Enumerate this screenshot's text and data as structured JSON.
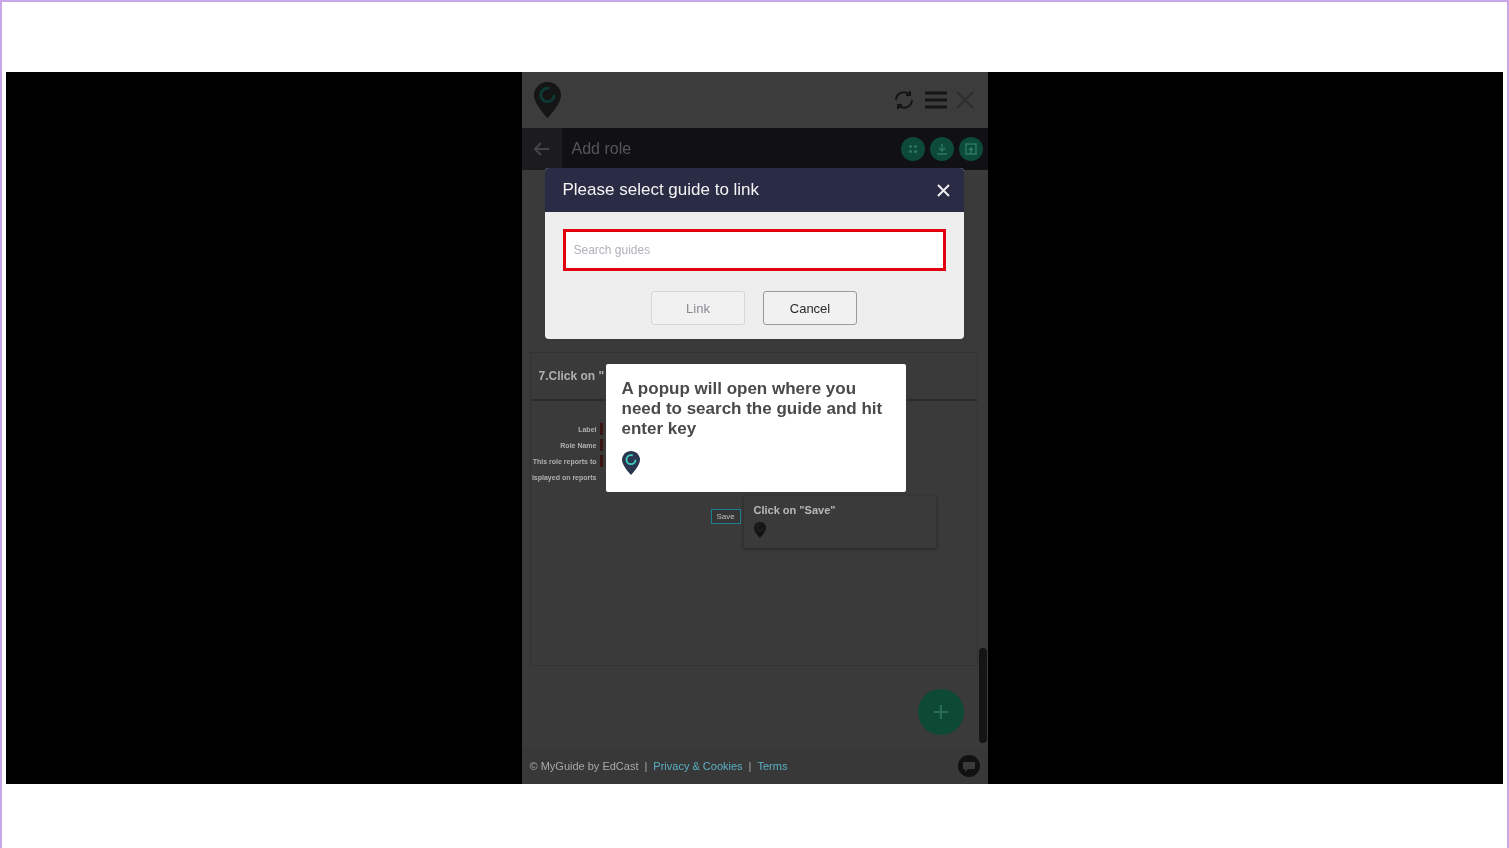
{
  "page_header": {
    "title": "Add role"
  },
  "modal": {
    "title": "Please select guide to link",
    "search": {
      "placeholder": "Search guides"
    },
    "buttons": [
      {
        "label": "Link",
        "disabled": true
      },
      {
        "label": "Cancel",
        "disabled": false
      }
    ]
  },
  "step_card": {
    "title": "7.Click on \""
  },
  "form": {
    "labels": [
      "Label",
      "Role Name",
      "This role reports to",
      "isplayed on reports"
    ],
    "save_button": "Save"
  },
  "step_tooltip": {
    "text": "Click on \"Save\""
  },
  "guide_tooltip": {
    "text": "A popup will open where you need to search the guide and hit enter key"
  },
  "footer": {
    "copyright": "© MyGuide by EdCast",
    "separators": [
      "|",
      "|"
    ],
    "links": [
      "Privacy & Cookies",
      "Terms"
    ]
  }
}
